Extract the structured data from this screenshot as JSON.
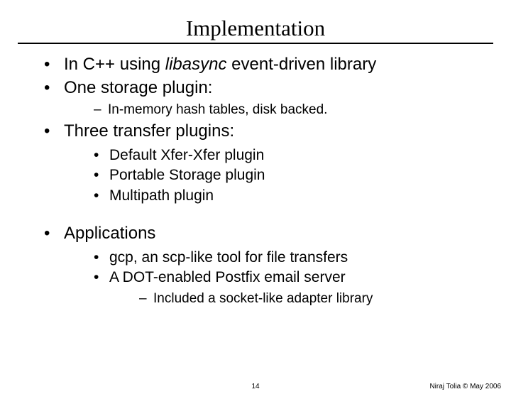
{
  "title": "Implementation",
  "bullets": {
    "b1_pre": "In C++ using ",
    "b1_italic": "libasync",
    "b1_post": " event-driven library",
    "b2": "One storage plugin:",
    "b2_sub1": "In-memory hash tables, disk backed.",
    "b3": "Three transfer plugins:",
    "b3_sub1": "Default Xfer-Xfer plugin",
    "b3_sub2": "Portable Storage plugin",
    "b3_sub3": "Multipath plugin",
    "b4": "Applications",
    "b4_sub1": "gcp, an scp-like tool for file transfers",
    "b4_sub2": "A DOT-enabled Postfix email server",
    "b4_sub2_sub1": "Included a socket-like adapter library"
  },
  "footer": {
    "page": "14",
    "author": "Niraj Tolia © May 2006"
  }
}
